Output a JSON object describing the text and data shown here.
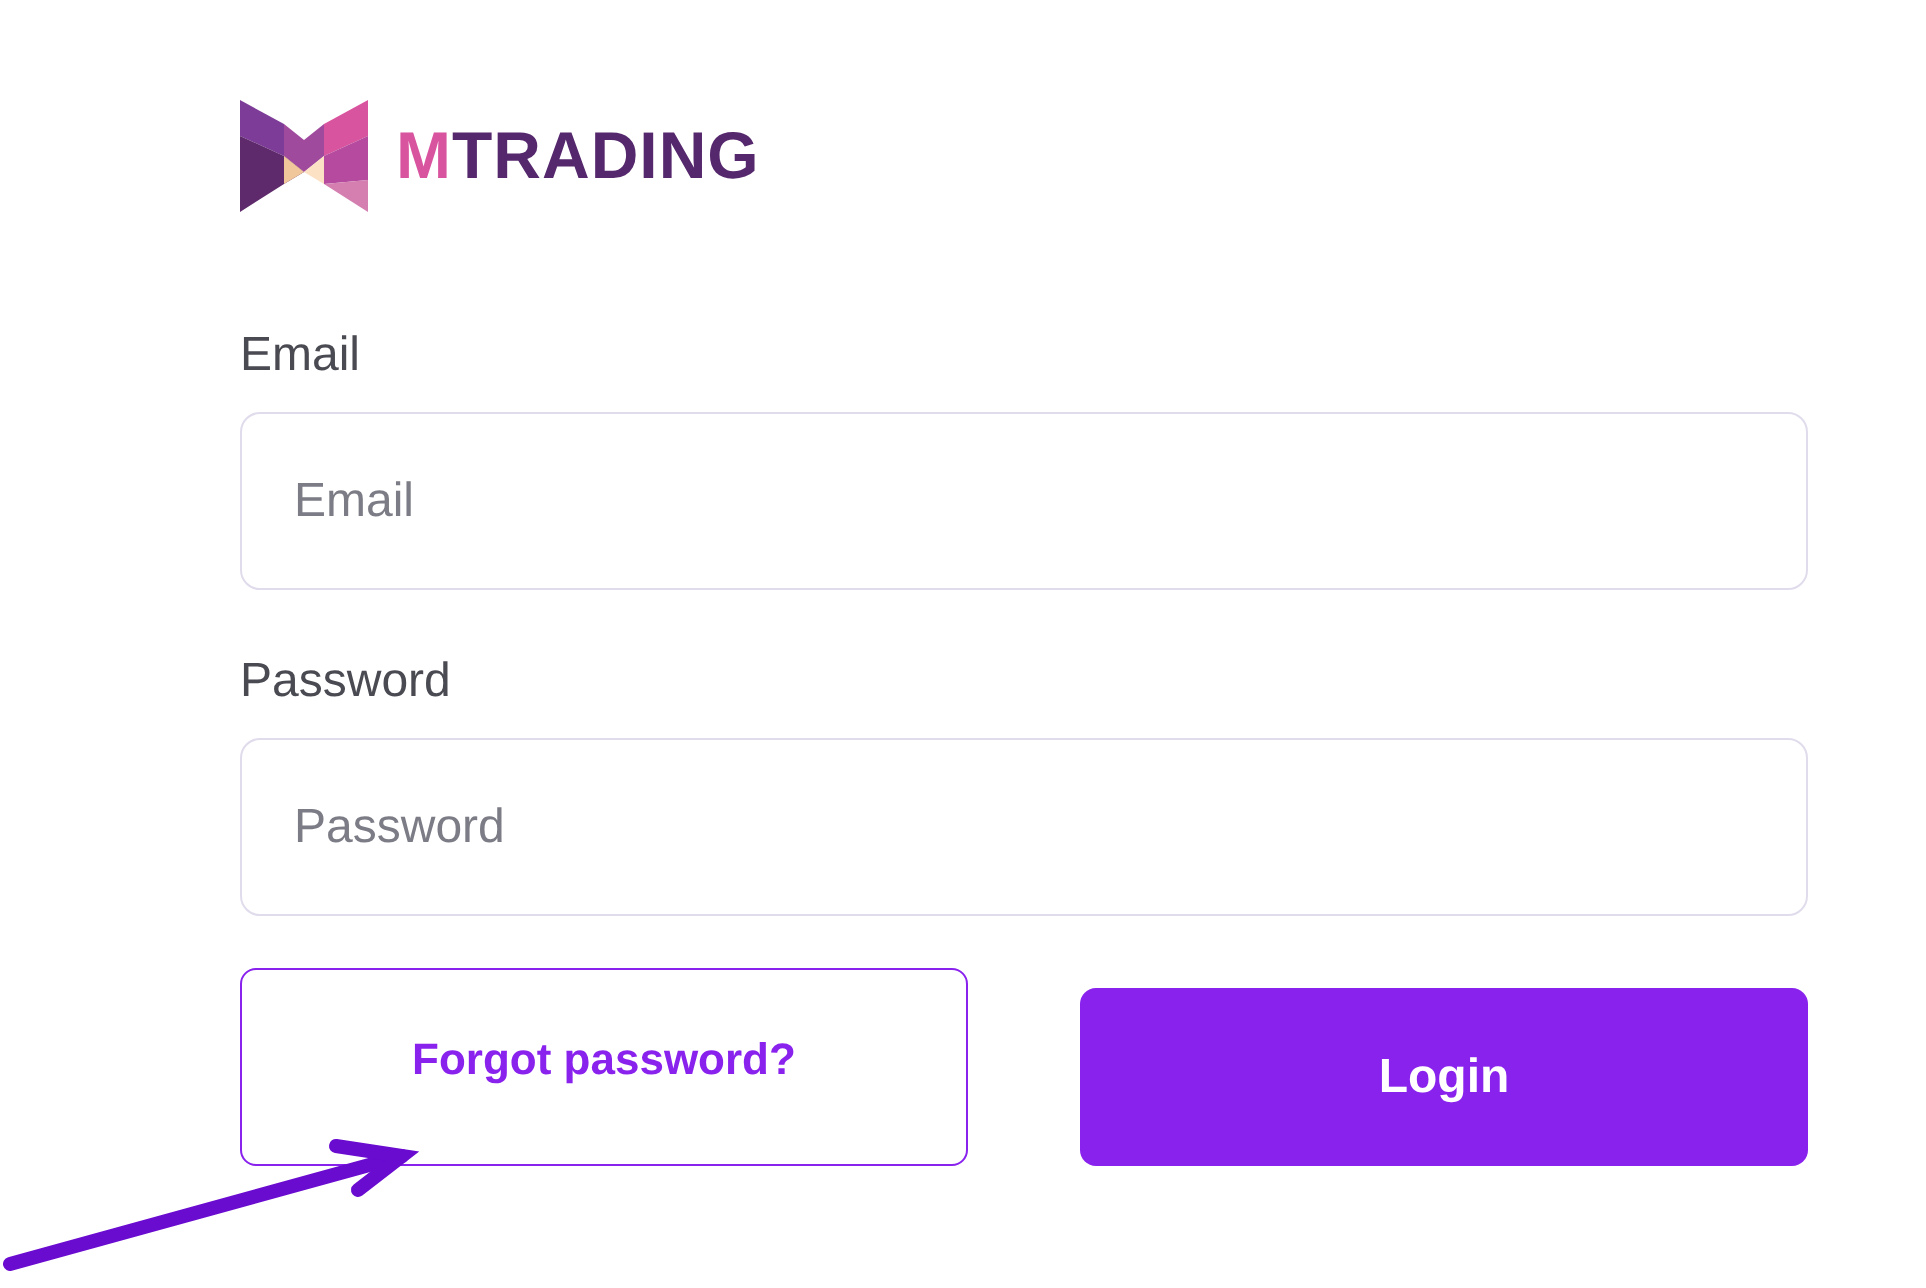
{
  "logo": {
    "parts": [
      {
        "text": "M",
        "color": "#d9549f"
      },
      {
        "text": "TRADING",
        "color": "#55276c"
      }
    ]
  },
  "fields": [
    {
      "label": "Email",
      "placeholder": "Email"
    },
    {
      "label": "Password",
      "placeholder": "Password"
    }
  ],
  "forgot_link": "Forgot password?",
  "login_button": "Login"
}
